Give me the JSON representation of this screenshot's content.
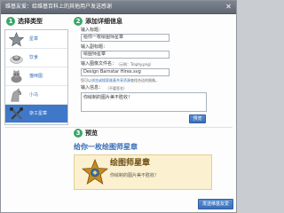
{
  "window": {
    "title": "维基友爱：给维基百科上的其他用户发送感谢"
  },
  "step1": {
    "number": "1",
    "heading": "选择类型"
  },
  "types": [
    {
      "label": "星章",
      "icon": "gray-star-icon"
    },
    {
      "label": "饮食",
      "icon": "food-icon"
    },
    {
      "label": "猫咪图",
      "icon": "cat-icon"
    },
    {
      "label": "小马",
      "icon": "horse-icon"
    },
    {
      "label": "杂工星章",
      "icon": "tools-icon",
      "selected": true
    }
  ],
  "step2": {
    "number": "2",
    "heading": "添加详细信息",
    "title_label": "输入标题：",
    "title_value": "给你一枚绘图师星章",
    "subtitle_label": "输入副标题：",
    "subtitle_value": "绘图师星章",
    "image_label": "输入图像文件名：",
    "image_placeholder": "（示例：Trophy.png）",
    "image_value": "Design Barnstar Hires.svg",
    "image_hint": "您可以",
    "image_hint_link": "浏览或搜索维基共享资源",
    "image_hint_tail": "查找合适的图像。",
    "message_label": "输入信息：",
    "message_hint": "（不要签名）",
    "message_value": "你绘制的图片美不胜收！",
    "preview_button": "预览"
  },
  "step3": {
    "number": "3",
    "heading": "预览",
    "preview_heading": "给你一枚绘图师星章",
    "barnstar_title": "绘图师星章",
    "barnstar_message": "你绘制的图片美不胜收！"
  },
  "submit_button": "发送维基友爱",
  "colors": {
    "accent": "#3a6fb8",
    "step": "#3aa66a",
    "preview_bg": "#fbf0cf"
  }
}
